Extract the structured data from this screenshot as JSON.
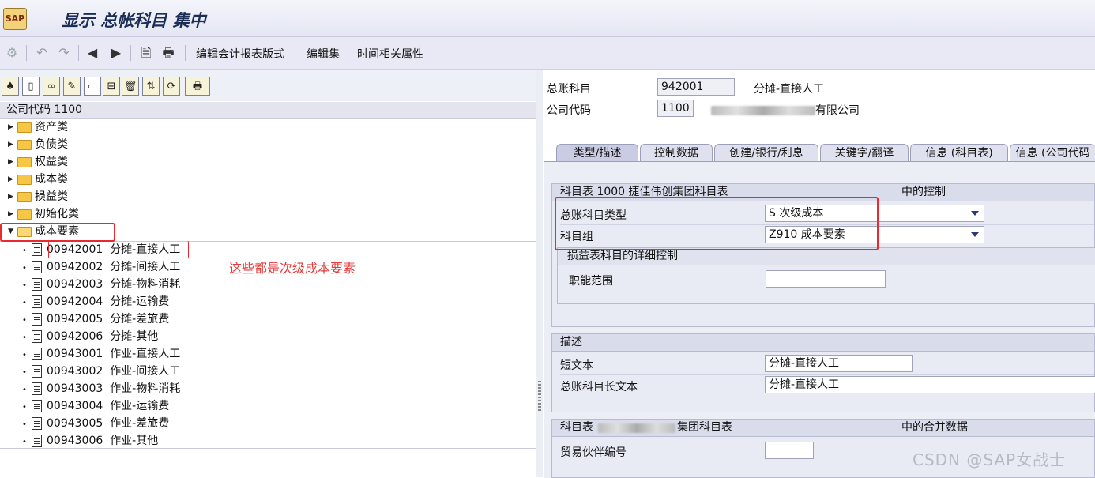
{
  "window": {
    "title": "显示 总帐科目 集中"
  },
  "toolbar": {
    "items": [
      "编辑会计报表版式",
      "编辑集",
      "时间相关属性"
    ]
  },
  "tree": {
    "header": "公司代码 1100",
    "folders": [
      "资产类",
      "负债类",
      "权益类",
      "成本类",
      "损益类",
      "初始化类"
    ],
    "expanded_folder": "成本要素",
    "accounts": [
      {
        "code": "00942001",
        "name": "分摊-直接人工"
      },
      {
        "code": "00942002",
        "name": "分摊-间接人工"
      },
      {
        "code": "00942003",
        "name": "分摊-物料消耗"
      },
      {
        "code": "00942004",
        "name": "分摊-运输费"
      },
      {
        "code": "00942005",
        "name": "分摊-差旅费"
      },
      {
        "code": "00942006",
        "name": "分摊-其他"
      },
      {
        "code": "00943001",
        "name": "作业-直接人工"
      },
      {
        "code": "00943002",
        "name": "作业-间接人工"
      },
      {
        "code": "00943003",
        "name": "作业-物料消耗"
      },
      {
        "code": "00943004",
        "name": "作业-运输费"
      },
      {
        "code": "00943005",
        "name": "作业-差旅费"
      },
      {
        "code": "00943006",
        "name": "作业-其他"
      }
    ],
    "annotation": "这些都是次级成本要素"
  },
  "header_fields": {
    "gl_account_label": "总账科目",
    "gl_account_value": "942001",
    "gl_account_desc": "分摊-直接人工",
    "company_code_label": "公司代码",
    "company_code_value": "1100",
    "company_name_suffix": "有限公司"
  },
  "tabs": [
    "类型/描述",
    "控制数据",
    "创建/银行/利息",
    "关键字/翻译",
    "信息 (科目表)",
    "信息 (公司代码"
  ],
  "control_group": {
    "head_left": "科目表 1000 捷佳伟创集团科目表",
    "head_right": "中的控制",
    "type_label": "总账科目类型",
    "type_value": "S 次级成本",
    "group_label": "科目组",
    "group_value": "Z910 成本要素",
    "pl_head": "损益表科目的详细控制",
    "func_area_label": "职能范围",
    "func_area_value": ""
  },
  "desc_group": {
    "head": "描述",
    "short_label": "短文本",
    "short_value": "分摊-直接人工",
    "long_label": "总账科目长文本",
    "long_value": "分摊-直接人工"
  },
  "consol_group": {
    "head_left_prefix": "科目表",
    "head_left_suffix": "集团科目表",
    "head_right": "中的合并数据",
    "partner_label": "贸易伙伴编号",
    "partner_value": ""
  },
  "watermark": "CSDN @SAP女战士",
  "colors": {
    "annotation_red": "#e8292f",
    "folder": "#f6c744"
  }
}
